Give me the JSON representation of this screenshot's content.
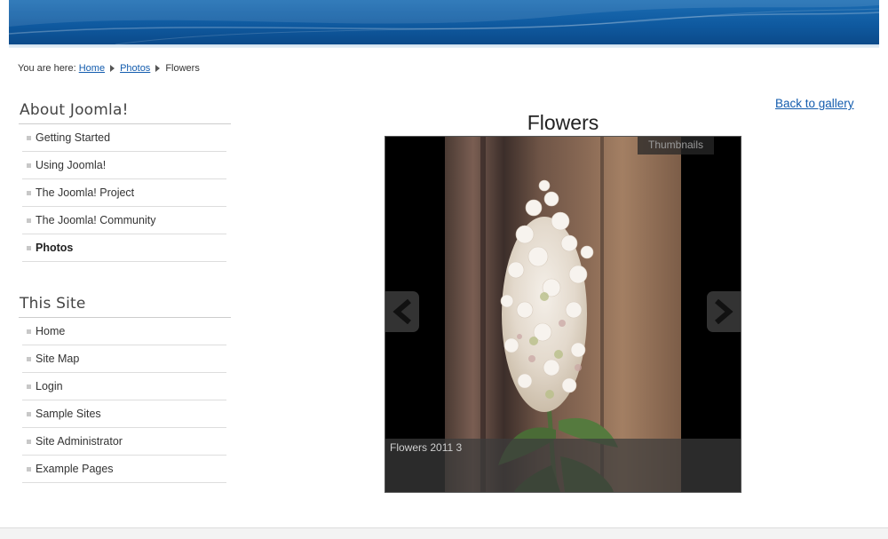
{
  "breadcrumb": {
    "prefix": "You are here:",
    "items": [
      {
        "label": "Home",
        "link": true
      },
      {
        "label": "Photos",
        "link": true
      },
      {
        "label": "Flowers",
        "link": false
      }
    ]
  },
  "sidebar": {
    "about": {
      "title": "About Joomla!",
      "items": [
        {
          "label": "Getting Started"
        },
        {
          "label": "Using Joomla!"
        },
        {
          "label": "The Joomla! Project"
        },
        {
          "label": "The Joomla! Community"
        },
        {
          "label": "Photos",
          "active": true
        }
      ]
    },
    "this_site": {
      "title": "This Site",
      "items": [
        {
          "label": "Home"
        },
        {
          "label": "Site Map"
        },
        {
          "label": "Login"
        },
        {
          "label": "Sample Sites"
        },
        {
          "label": "Site Administrator"
        },
        {
          "label": "Example Pages"
        }
      ]
    }
  },
  "main": {
    "back_link": "Back to gallery",
    "gallery_title": "Flowers",
    "thumbnails_label": "Thumbnails",
    "caption": "Flowers 2011 3"
  },
  "colors": {
    "header_blue": "#0f5aa0",
    "link": "#135cae"
  },
  "icons": {
    "prev": "chevron-left-icon",
    "next": "chevron-right-icon"
  }
}
